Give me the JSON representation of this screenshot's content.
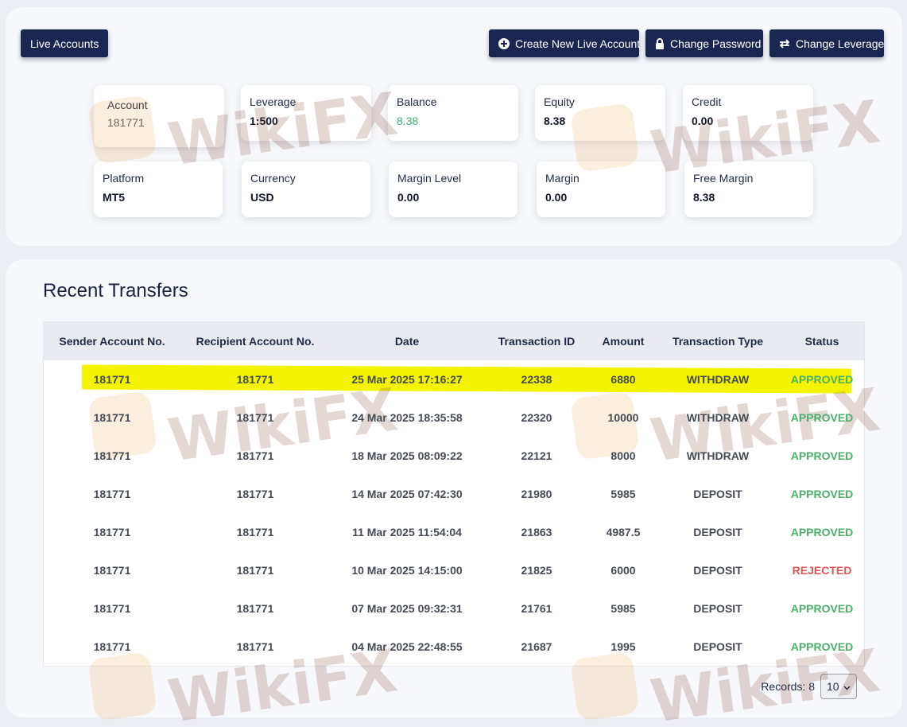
{
  "buttons": {
    "live_accounts": "Live Accounts",
    "create_new_live_account": "Create New Live Account",
    "change_password": "Change Password",
    "change_leverage": "Change Leverage"
  },
  "account_cards": [
    {
      "label": "Account",
      "value": "181771"
    },
    {
      "label": "Leverage",
      "value": "1:500"
    },
    {
      "label": "Balance",
      "value": "8.38"
    },
    {
      "label": "Equity",
      "value": "8.38"
    },
    {
      "label": "Credit",
      "value": "0.00"
    },
    {
      "label": "Platform",
      "value": "MT5"
    },
    {
      "label": "Currency",
      "value": "USD"
    },
    {
      "label": "Margin Level",
      "value": "0.00"
    },
    {
      "label": "Margin",
      "value": "0.00"
    },
    {
      "label": "Free Margin",
      "value": "8.38"
    }
  ],
  "transfers": {
    "title": "Recent Transfers",
    "columns": [
      "Sender Account No.",
      "Recipient Account No.",
      "Date",
      "Transaction ID",
      "Amount",
      "Transaction Type",
      "Status"
    ],
    "rows": [
      [
        "181771",
        "181771",
        "25 Mar 2025 17:16:27",
        "22338",
        "6880",
        "WITHDRAW",
        "APPROVED"
      ],
      [
        "181771",
        "181771",
        "24 Mar 2025 18:35:58",
        "22320",
        "10000",
        "WITHDRAW",
        "APPROVED"
      ],
      [
        "181771",
        "181771",
        "18 Mar 2025 08:09:22",
        "22121",
        "8000",
        "WITHDRAW",
        "APPROVED"
      ],
      [
        "181771",
        "181771",
        "14 Mar 2025 07:42:30",
        "21980",
        "5985",
        "DEPOSIT",
        "APPROVED"
      ],
      [
        "181771",
        "181771",
        "11 Mar 2025 11:54:04",
        "21863",
        "4987.5",
        "DEPOSIT",
        "APPROVED"
      ],
      [
        "181771",
        "181771",
        "10 Mar 2025 14:15:00",
        "21825",
        "6000",
        "DEPOSIT",
        "REJECTED"
      ],
      [
        "181771",
        "181771",
        "07 Mar 2025 09:32:31",
        "21761",
        "5985",
        "DEPOSIT",
        "APPROVED"
      ],
      [
        "181771",
        "181771",
        "04 Mar 2025 22:48:55",
        "21687",
        "1995",
        "DEPOSIT",
        "APPROVED"
      ]
    ],
    "highlighted_row": 0,
    "records_label": "Records: 8",
    "page_size": "10"
  },
  "watermark": "WikiFX",
  "colors": {
    "button_bg": "#1a2650",
    "approved": "#4caf6a",
    "rejected": "#e05555",
    "balance": "#3cb371",
    "highlight": "#f4f300"
  }
}
